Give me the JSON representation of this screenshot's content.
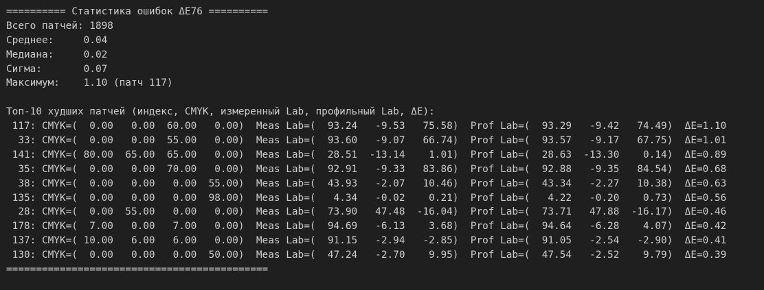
{
  "terminal": {
    "lines": [
      "========== Статистика ошибок ΔE76 ==========",
      "Всего патчей: 1898",
      "Среднее:     0.04",
      "Медиана:     0.02",
      "Сигма:       0.07",
      "Максимум:    1.10 (патч 117)",
      "",
      "Топ-10 худших патчей (индекс, CMYK, измеренный Lab, профильный Lab, ΔE):",
      " 117: CMYK=(  0.00   0.00  60.00   0.00)  Meas Lab=(  93.24   -9.53   75.58)  Prof Lab=(  93.29   -9.42   74.49)  ΔE=1.10",
      "  33: CMYK=(  0.00   0.00  55.00   0.00)  Meas Lab=(  93.60   -9.07   66.74)  Prof Lab=(  93.57   -9.17   67.75)  ΔE=1.01",
      " 141: CMYK=( 80.00  65.00  65.00   0.00)  Meas Lab=(  28.51  -13.14    1.01)  Prof Lab=(  28.63  -13.30    0.14)  ΔE=0.89",
      "  35: CMYK=(  0.00   0.00  70.00   0.00)  Meas Lab=(  92.91   -9.33   83.86)  Prof Lab=(  92.88   -9.35   84.54)  ΔE=0.68",
      "  38: CMYK=(  0.00   0.00   0.00  55.00)  Meas Lab=(  43.93   -2.07   10.46)  Prof Lab=(  43.34   -2.27   10.38)  ΔE=0.63",
      " 135: CMYK=(  0.00   0.00   0.00  98.00)  Meas Lab=(   4.34   -0.02    0.21)  Prof Lab=(   4.22   -0.20    0.73)  ΔE=0.56",
      "  28: CMYK=(  0.00  55.00   0.00   0.00)  Meas Lab=(  73.90   47.48  -16.04)  Prof Lab=(  73.71   47.88  -16.17)  ΔE=0.46",
      " 178: CMYK=(  7.00   0.00   7.00   0.00)  Meas Lab=(  94.69   -6.13    3.68)  Prof Lab=(  94.64   -6.28    4.07)  ΔE=0.42",
      " 137: CMYK=( 10.00   6.00   6.00   0.00)  Meas Lab=(  91.15   -2.94   -2.85)  Prof Lab=(  91.05   -2.54   -2.90)  ΔE=0.41",
      " 130: CMYK=(  0.00   0.00   0.00  50.00)  Meas Lab=(  47.24   -2.70    9.95)  Prof Lab=(  47.54   -2.52    9.79)  ΔE=0.39",
      "============================================"
    ]
  },
  "colors": {
    "background": "#1f1f1f",
    "text": "#cccccc"
  }
}
